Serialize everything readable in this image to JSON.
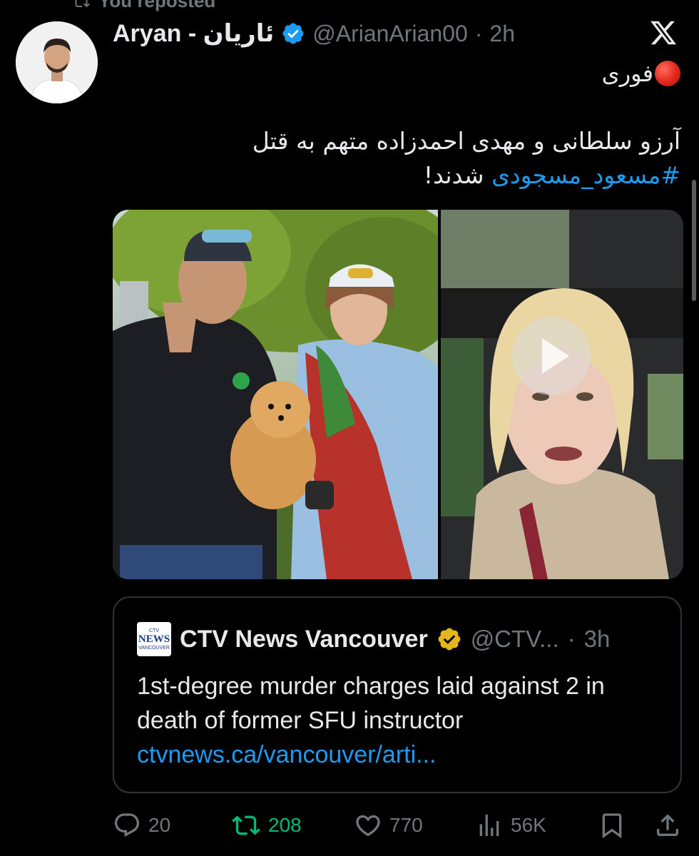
{
  "repost": {
    "label": "You reposted"
  },
  "post": {
    "display_name": "Aryan - ئاریان",
    "handle": "@ArianArian00",
    "separator": "·",
    "time": "2h",
    "urgent_label": "فوری",
    "text_line_1": "آرزو سلطانی و مهدی احمدزاده متهم به قتل",
    "hashtag": "#مسعود_مسجودی",
    "text_line_2_rest": " شدند!"
  },
  "quote": {
    "logo_top": "CTV",
    "logo_text": "NEWS",
    "logo_sub": "VANCOUVER",
    "name": "CTV News Vancouver",
    "handle": "@CTV...",
    "separator": "·",
    "time": "3h",
    "text": "1st-degree murder charges laid against 2 in death of former SFU instructor",
    "link": "ctvnews.ca/vancouver/arti..."
  },
  "actions": {
    "replies": "20",
    "reposts": "208",
    "likes": "770",
    "views": "56K"
  },
  "colors": {
    "background": "#000000",
    "text": "#e7e9ea",
    "secondary": "#71767b",
    "link": "#1d9bf0",
    "retweet_active": "#00ba7c",
    "verified_blue": "#1d9bf0",
    "verified_gold": "#e2b719"
  },
  "icons": {
    "verified": "verified-badge-icon",
    "gold_verified": "gold-verified-badge-icon",
    "x_logo": "x-logo-icon",
    "reply": "reply-icon",
    "repost": "repost-icon",
    "like": "heart-icon",
    "views": "views-chart-icon",
    "bookmark": "bookmark-icon",
    "share": "share-icon"
  }
}
